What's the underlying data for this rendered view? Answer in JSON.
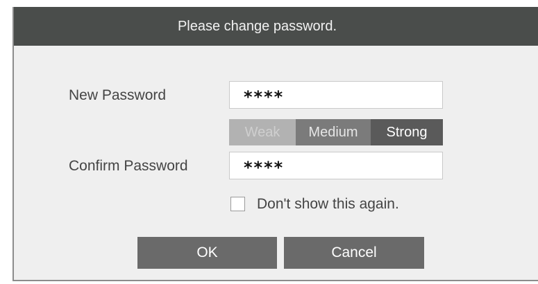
{
  "dialog": {
    "title": "Please change password.",
    "new_password": {
      "label": "New Password",
      "value": "****"
    },
    "strength": {
      "weak": "Weak",
      "medium": "Medium",
      "strong": "Strong"
    },
    "confirm_password": {
      "label": "Confirm Password",
      "value": "****"
    },
    "dont_show": {
      "label": "Don't show this again.",
      "checked": false
    },
    "buttons": {
      "ok": "OK",
      "cancel": "Cancel"
    }
  }
}
